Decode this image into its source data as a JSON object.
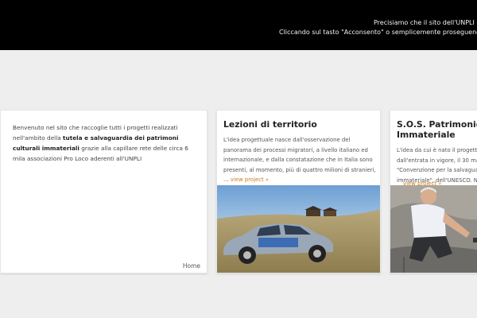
{
  "cookie_bar": {
    "line1": "Precisiamo che il sito dell'UNPLI - Unione",
    "line2": "Cliccando sul tasto \"Acconsento\" o semplicemente proseguendo nella navigaz"
  },
  "intro": {
    "text_a": "Benvenuto nel sito che raccoglie tutti i progetti realizzati nell'ambito della ",
    "text_bold": "tutela e salvaguardia dei patrimoni culturali immateriali",
    "text_b": " grazie alla capillare rete delle circa 6 mila associazioni Pro Loco aderenti all'UNPLI",
    "home_link": "Home"
  },
  "cards": [
    {
      "title": "Lezioni di territorio",
      "text": "L'idea progettuale nasce dall'osservazione del panorama dei processi migratori, a livello italiano ed internazionale, e dalla constatazione che in Italia sono presenti, al momento, più di quattro milioni di stranieri, ... ",
      "view_label": "view project »"
    },
    {
      "title": "S.O.S. Patrimonio Cu Immateriale",
      "text": "L'idea da cui è nato il progetto c dall'entrata in vigore, il 30 maggi \"Convenzione per la salvaguard immateriale\", dell'UNESCO. Nel",
      "view_label": "view project »"
    }
  ],
  "colors": {
    "cookie_bg": "#000000",
    "page_bg": "#eeeeee",
    "accent": "#c97a1c"
  }
}
